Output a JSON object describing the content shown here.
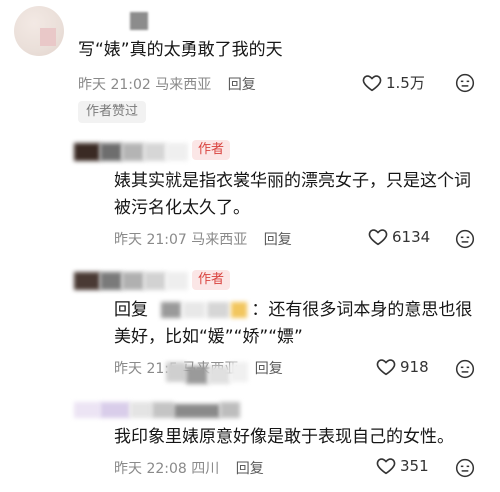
{
  "comment": {
    "text": "写“婊”真的太勇敢了我的天",
    "time": "昨天 21:02",
    "location": "马来西亚",
    "reply_label": "回复",
    "likes": "1.5万",
    "author_liked_tag": "作者赞过"
  },
  "replies": [
    {
      "author_badge": "作者",
      "text_line1": "婊其实就是指衣裳华丽的漂亮女子，只是这个词",
      "text_line2": "被污名化太久了。",
      "time": "昨天 21:07",
      "location": "马来西亚",
      "reply_label": "回复",
      "likes": "6134"
    },
    {
      "author_badge": "作者",
      "reply_prefix": "回复",
      "text_line1": "：还有很多词本身的意思也很",
      "text_line2": "美好，比如“媛”“娇”“嫖”",
      "time": "昨天 21:5",
      "location": "马来西亚",
      "reply_label": "回复",
      "likes": "918"
    },
    {
      "text_line1": "我印象里婊原意好像是敢于表现自己的女性。",
      "time": "昨天 22:08",
      "location": "四川",
      "reply_label": "回复",
      "likes": "351"
    }
  ],
  "icons": {
    "like": "heart-outline-icon",
    "dislike": "dislike-face-icon"
  },
  "colors": {
    "author_badge_text": "#d9433f",
    "author_badge_bg": "#fbe6e6",
    "meta_text": "#8a8a8a"
  }
}
